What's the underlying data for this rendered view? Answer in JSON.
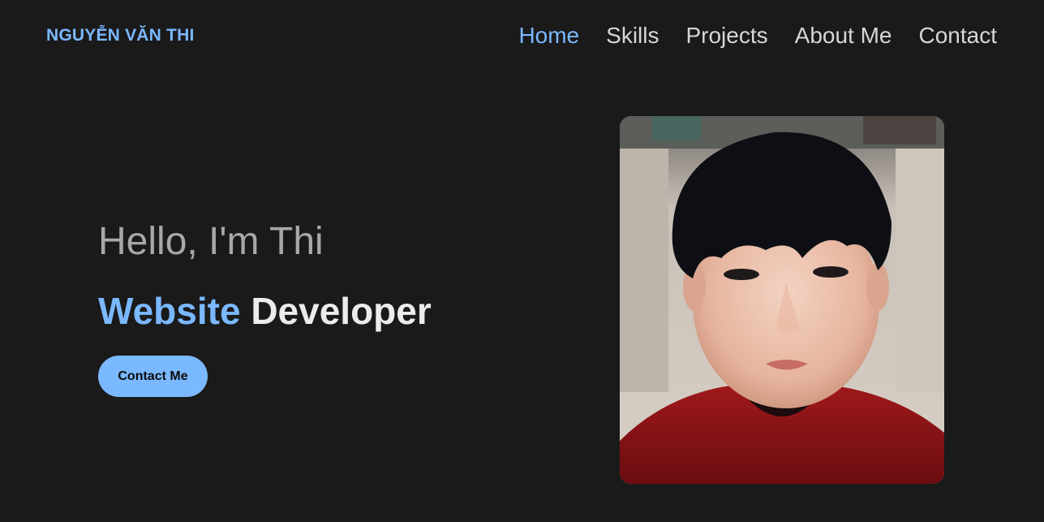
{
  "header": {
    "brand": "NGUYỄN VĂN THI",
    "nav": [
      {
        "label": "Home",
        "active": true
      },
      {
        "label": "Skills",
        "active": false
      },
      {
        "label": "Projects",
        "active": false
      },
      {
        "label": "About Me",
        "active": false
      },
      {
        "label": "Contact",
        "active": false
      }
    ]
  },
  "hero": {
    "greeting": "Hello, I'm Thi",
    "role_accent": "Website",
    "role_rest": "Developer",
    "cta_label": "Contact Me"
  },
  "colors": {
    "background": "#1a1a1a",
    "accent": "#7ab8ff",
    "nav_text": "#d6d6d6",
    "greeting_text": "#a8a8a8"
  }
}
